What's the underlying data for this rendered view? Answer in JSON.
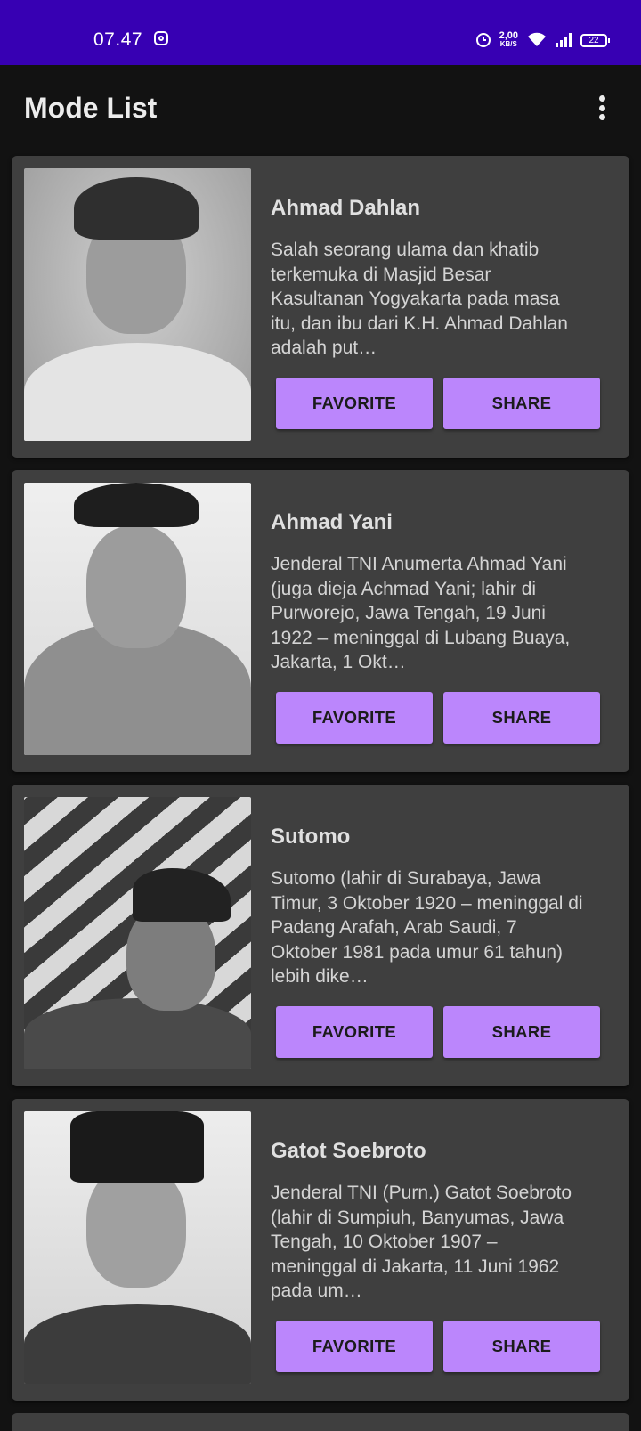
{
  "status_bar": {
    "time": "07.47",
    "net_speed_value": "2,00",
    "net_speed_unit": "KB/S",
    "battery": "22",
    "icons": [
      "instagram-icon",
      "alarm-icon",
      "wifi-icon",
      "signal-icon",
      "battery-icon"
    ]
  },
  "app_bar": {
    "title": "Mode List",
    "menu_icon": "more-vert-icon"
  },
  "colors": {
    "status_bar": "#3700b3",
    "background": "#121212",
    "card": "#3f3f3f",
    "button": "#bb86fc"
  },
  "heroes": [
    {
      "name": "Ahmad Dahlan",
      "description": "Salah seorang ulama dan khatib terkemuka di Masjid Besar Kasultanan Yogyakarta pada masa itu, dan ibu dari K.H. Ahmad Dahlan adalah put…",
      "favorite_label": "FAVORITE",
      "share_label": "SHARE"
    },
    {
      "name": "Ahmad Yani",
      "description": "Jenderal TNI Anumerta Ahmad Yani (juga dieja Achmad Yani; lahir di Purworejo, Jawa Tengah, 19 Juni 1922 – meninggal di Lubang Buaya, Jakarta, 1 Okt…",
      "favorite_label": "FAVORITE",
      "share_label": "SHARE"
    },
    {
      "name": "Sutomo",
      "description": "Sutomo (lahir di Surabaya, Jawa Timur, 3 Oktober 1920 – meninggal di Padang Arafah, Arab Saudi, 7 Oktober 1981 pada umur 61 tahun) lebih dike…",
      "favorite_label": "FAVORITE",
      "share_label": "SHARE"
    },
    {
      "name": "Gatot Soebroto",
      "description": "Jenderal TNI (Purn.) Gatot Soebroto (lahir di Sumpiuh, Banyumas, Jawa Tengah, 10 Oktober 1907 – meninggal di Jakarta, 11 Juni 1962 pada um…",
      "favorite_label": "FAVORITE",
      "share_label": "SHARE"
    }
  ]
}
